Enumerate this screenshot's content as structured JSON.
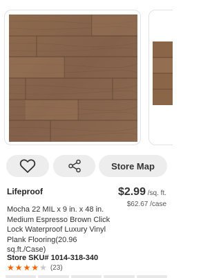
{
  "gallery": {
    "main_image_icon": "wood-floor-plank-image",
    "next_image_icon": "wood-floor-plank-image"
  },
  "actions": {
    "favorite_icon": "heart-icon",
    "share_icon": "share-icon",
    "store_map_label": "Store Map"
  },
  "product": {
    "brand": "Lifeproof",
    "price": "$2.99",
    "price_unit": " /sq. ft.",
    "price_case": "$62.67 /case",
    "title": "Mocha 22 MIL x 9 in. x 48 in. Medium Espresso Brown Click Lock Waterproof Luxury Vinyl Plank Flooring(20.96 sq.ft./Case)",
    "sku": "Store SKU# 1014-318-340",
    "rating": 4,
    "rating_max": 5,
    "review_count": "(23)"
  },
  "colors": {
    "star_active": "#f96302",
    "wood_base": "#8a6548"
  }
}
